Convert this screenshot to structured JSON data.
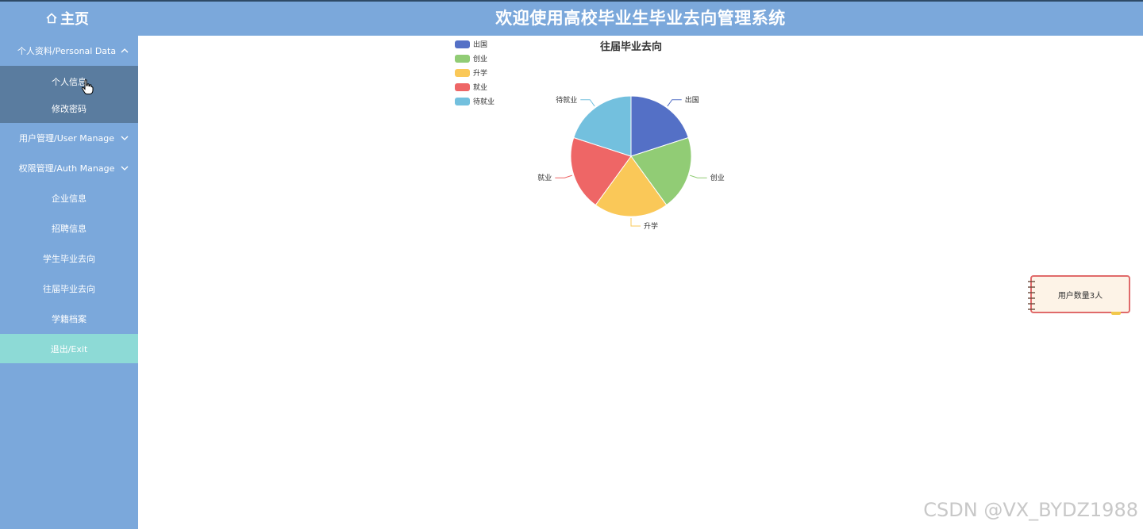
{
  "header": {
    "home_label": "主页",
    "title": "欢迎使用高校毕业生毕业去向管理系统"
  },
  "sidebar": {
    "group_personal": {
      "label": "个人资料/Personal Data",
      "items": [
        "个人信息",
        "修改密码"
      ]
    },
    "group_user": {
      "label": "用户管理/User Manage"
    },
    "group_auth": {
      "label": "权限管理/Auth Manage"
    },
    "items": [
      "企业信息",
      "招聘信息",
      "学生毕业去向",
      "往届毕业去向",
      "学籍档案"
    ],
    "exit": "退出/Exit"
  },
  "chart_data": {
    "type": "pie",
    "title": "往届毕业去向",
    "legend_position": "top-left",
    "categories": [
      "出国",
      "创业",
      "升学",
      "就业",
      "待就业"
    ],
    "values": [
      1,
      1,
      1,
      1,
      1
    ],
    "colors": [
      "#5470c6",
      "#91cc75",
      "#fac858",
      "#ee6666",
      "#73c0de"
    ]
  },
  "note": {
    "text": "用户数量3人"
  },
  "watermark": "CSDN @VX_BYDZ1988"
}
